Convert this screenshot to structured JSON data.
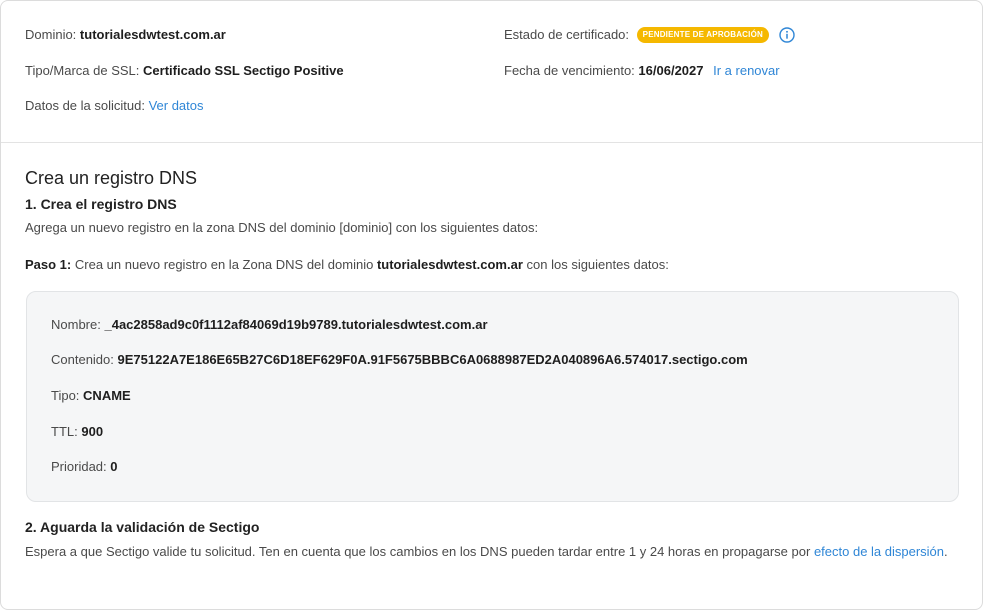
{
  "certificate": {
    "domain_label": "Dominio:",
    "domain_value": "tutorialesdwtest.com.ar",
    "ssl_type_label": "Tipo/Marca de SSL:",
    "ssl_type_value": "Certificado SSL Sectigo Positive",
    "request_label": "Datos de la solicitud:",
    "request_link": "Ver datos",
    "status_label": "Estado de certificado:",
    "status_badge": "PENDIENTE DE APROBACIÓN",
    "status_badge_color": "#f5b800",
    "status_icon": "info-icon",
    "expiry_label": "Fecha de vencimiento:",
    "expiry_value": "16/06/2027",
    "renew_link": "Ir a renovar"
  },
  "dns": {
    "title": "Crea un registro DNS",
    "step1_title": "1. Crea el registro DNS",
    "step1_desc": "Agrega un nuevo registro en la zona DNS del dominio [dominio] con los siguientes datos:",
    "paso_label": "Paso 1:",
    "paso_text_a": "Crea un nuevo registro en la Zona DNS del dominio",
    "paso_domain": "tutorialesdwtest.com.ar",
    "paso_text_b": "con los siguientes datos:",
    "record": {
      "name_label": "Nombre:",
      "name_value": "_4ac2858ad9c0f1112af84069d19b9789.tutorialesdwtest.com.ar",
      "content_label": "Contenido:",
      "content_value": "9E75122A7E186E65B27C6D18EF629F0A.91F5675BBBC6A0688987ED2A040896A6.574017.sectigo.com",
      "type_label": "Tipo:",
      "type_value": "CNAME",
      "ttl_label": "TTL:",
      "ttl_value": "900",
      "priority_label": "Prioridad:",
      "priority_value": "0"
    },
    "step2_title": "2. Aguarda la validación de Sectigo",
    "step2_desc": "Espera a que Sectigo valide tu solicitud. Ten en cuenta que los cambios en los DNS pueden tardar entre 1 y 24 horas en propagarse por",
    "step2_link": "efecto de la dispersión",
    "step2_end": "."
  },
  "colors": {
    "link": "#2f86d6",
    "badge": "#f5b800"
  }
}
